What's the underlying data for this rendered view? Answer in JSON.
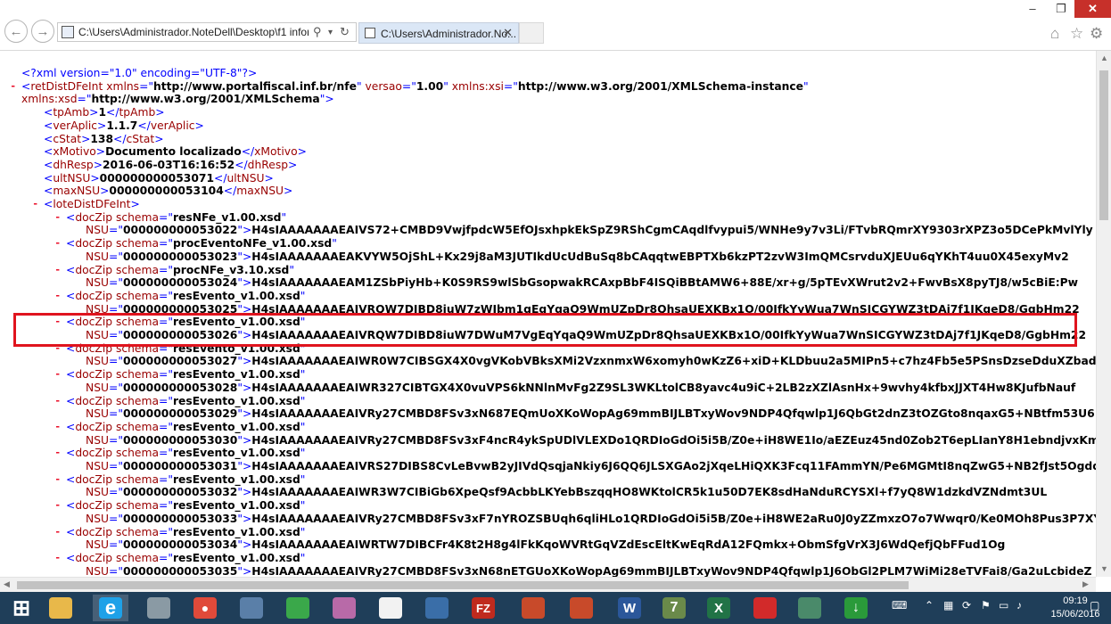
{
  "browser": {
    "address_text": "C:\\Users\\Administrador.NoteDell\\Desktop\\f1 informat",
    "tab_title": "C:\\Users\\Administrador.No...",
    "icons": {
      "back": "back-arrow-icon",
      "forward": "forward-arrow-icon",
      "search": "search-icon",
      "refresh": "refresh-icon",
      "close_tab": "close-icon",
      "home": "home-icon",
      "favorites": "star-icon",
      "settings": "gear-icon"
    }
  },
  "window_controls": {
    "minimize": "–",
    "restore": "❐",
    "close": "✕"
  },
  "xml": {
    "decl": "<?xml version=\"1.0\" encoding=\"UTF-8\"?>",
    "root_tag": "retDistDFeInt",
    "root_attrs": [
      {
        "name": "xmlns",
        "value": "http://www.portalfiscal.inf.br/nfe"
      },
      {
        "name": "versao",
        "value": "1.00"
      },
      {
        "name": "xmlns:xsi",
        "value": "http://www.w3.org/2001/XMLSchema-instance"
      },
      {
        "name": "xmlns:xsd",
        "value": "http://www.w3.org/2001/XMLSchema"
      }
    ],
    "simple": [
      {
        "tag": "tpAmb",
        "value": "1"
      },
      {
        "tag": "verAplic",
        "value": "1.1.7"
      },
      {
        "tag": "cStat",
        "value": "138"
      },
      {
        "tag": "xMotivo",
        "value": "Documento localizado"
      },
      {
        "tag": "dhResp",
        "value": "2016-06-03T16:16:52"
      },
      {
        "tag": "ultNSU",
        "value": "000000000053071"
      },
      {
        "tag": "maxNSU",
        "value": "000000000053104"
      }
    ],
    "lote_tag": "loteDistDFeInt",
    "doczips": [
      {
        "schema": "resNFe_v1.00.xsd",
        "nsu": "000000000053022",
        "content": "H4sIAAAAAAAEAIVS72+CMBD9VwjfpdcW5EfOJsxhpkEkSpZ9RShCgmCAqdlfvypui5/WNHe9y7v3Li/FTvbRQmrXY9303rXPZ3o5DCePkMvlYly"
      },
      {
        "schema": "procEventoNFe_v1.00.xsd",
        "nsu": "000000000053023",
        "content": "H4sIAAAAAAAEAKVYW5OjShL+Kx29j8aM3JUTIkdUcUdBuSq8bCAqqtwEBPTXb6kzPT2zvW3ImQMCsrvduXJEUu6qYKhT4uu0X45exyMv2"
      },
      {
        "schema": "procNFe_v3.10.xsd",
        "nsu": "000000000053024",
        "content": "H4sIAAAAAAAEAM1ZSbPiyHb+K0S9RS9wlSbGsopwakRCAxpBbF4ISQiBBtAMW6+88E/xr+g/5pTEvXWrut2v2+FwvBsX8pyTJ8/w5cBiE:Pw"
      },
      {
        "schema": "resEvento_v1.00.xsd",
        "nsu": "000000000053025",
        "content": "H4sIAAAAAAAEAIVRQW7DIBD8iuW7zWIbm1gEqYqaQ9WmUZpDr8QhsaUEXKBx1O/00IfkYyWua7WnSICGYWZ3tDAj7f1JKqeD8/GgbHm22"
      },
      {
        "schema": "resEvento_v1.00.xsd",
        "nsu": "000000000053026",
        "content": "H4sIAAAAAAAEAIVRQW7DIBD8iuW7DWuM7VgEqYqaQ9WmUZpDr8QhsaUEXKBx1O/00IfkYyWua7WnSICGYWZ3tDAj7f1JKqeD8/GgbHm22"
      },
      {
        "schema": "resEvento_v1.00.xsd",
        "nsu": "000000000053027",
        "content": "H4sIAAAAAAAEAIWR0W7CIBSGX4X0vgVKobVBksXMi2VzxnmxW6xomyh0wKzZ6+xiD+KLDbuu2a5MIPn5+c7hz4Fb5e5PSnsDzseDduXZbad"
      },
      {
        "schema": "resEvento_v1.00.xsd",
        "nsu": "000000000053028",
        "content": "H4sIAAAAAAAEAIWR327CIBTGX4X0vuVPS6kNNlnMvFg2Z9SL3WKLtolCB8yavc4u9iC+2LB2zXZlAsnHx+9wvhy4kfbxJJXT4Hw8KJufbNauf"
      },
      {
        "schema": "resEvento_v1.00.xsd",
        "nsu": "000000000053029",
        "content": "H4sIAAAAAAAEAIVRy27CMBD8FSv3xN687EQmUoXKoWopAg69mmBIJLBTxyWov9NDP4Qfqwlp1J6QbGt2dnZ3tOZGto8nqaxG5+NBtfm53U6"
      },
      {
        "schema": "resEvento_v1.00.xsd",
        "nsu": "000000000053030",
        "content": "H4sIAAAAAAAEAIVRy27CMBD8FSv3xF4ncR4ykSpUDlVLEXDo1QRDIoGdOi5i5B/Z0e+iH8WE1Io/aEZEuz45nd0Zob2T6epLIanY8H1ebndjvxKm"
      },
      {
        "schema": "resEvento_v1.00.xsd",
        "nsu": "000000000053031",
        "content": "H4sIAAAAAAAEAIVRS27DIBS8CvLeBvwB2yJIVdQsqjaNkiy6J6QQ6JLSXGAo2jXqeLHiQXK3Fcq11FAmmYN/Pe6MGMtI8nqZwG5+NB2fJst5Ogdq"
      },
      {
        "schema": "resEvento_v1.00.xsd",
        "nsu": "000000000053032",
        "content": "H4sIAAAAAAAEAIWR3W7CIBiGb6XpeQsf9AcbbLKYebBszqqHO8WKtolCR5k1u50D7EK8sdHaNduRCYSXl+f7yQ8W1dzkdVZNdmt3UL"
      },
      {
        "schema": "resEvento_v1.00.xsd",
        "nsu": "000000000053033",
        "content": "H4sIAAAAAAAEAIVRy27CMBD8FSv3xF7nYROZSBUqh6qliHLo1QRDIoGdOi5i5B/Z0e+iH8WE2aRu0J0yZZmxzO7o7Wwqr0/Ke0MOh8Pus3P7XYa"
      },
      {
        "schema": "resEvento_v1.00.xsd",
        "nsu": "000000000053034",
        "content": "H4sIAAAAAAAEAIWRTW7DIBCFr4K8t2H8g4lFkKqoWVRtGqVZdEscEltKwEqRdA12FQmkx+ObmSfgVrX3J6WdQefjQbFFud1Og"
      },
      {
        "schema": "resEvento_v1.00.xsd",
        "nsu": "000000000053035",
        "content": "H4sIAAAAAAAEAIVRy27CMBD8FSv3xN68nETGUoXKoWopAg69mmBIJLBTxyWov9NDP4Qfqwlp1J6ObGl2PLM7WiMi28eTVFai8/Ga2uLcbideZ"
      }
    ]
  },
  "taskbar": {
    "apps": [
      "start-icon",
      "file-explorer-icon",
      "internet-explorer-icon",
      "database-icon",
      "chrome-icon",
      "box-icon",
      "network-icon",
      "package-icon",
      "document-icon",
      "computer-icon",
      "filezilla-icon",
      "game-icon",
      "game-icon",
      "word-icon",
      "seven-zip-icon",
      "excel-icon",
      "app-icon",
      "window-icon",
      "download-icon"
    ],
    "tray_icons": [
      "keyboard-icon",
      "chevron-up-icon",
      "network-icon",
      "sync-icon",
      "flag-icon",
      "battery-icon",
      "volume-icon",
      "notification-icon"
    ],
    "start_glyph": "⊞",
    "filezilla_label": "FZ",
    "word_label": "W",
    "excel_label": "X",
    "seven_zip_label": "7",
    "time": "09:19",
    "date": "15/06/2016"
  }
}
